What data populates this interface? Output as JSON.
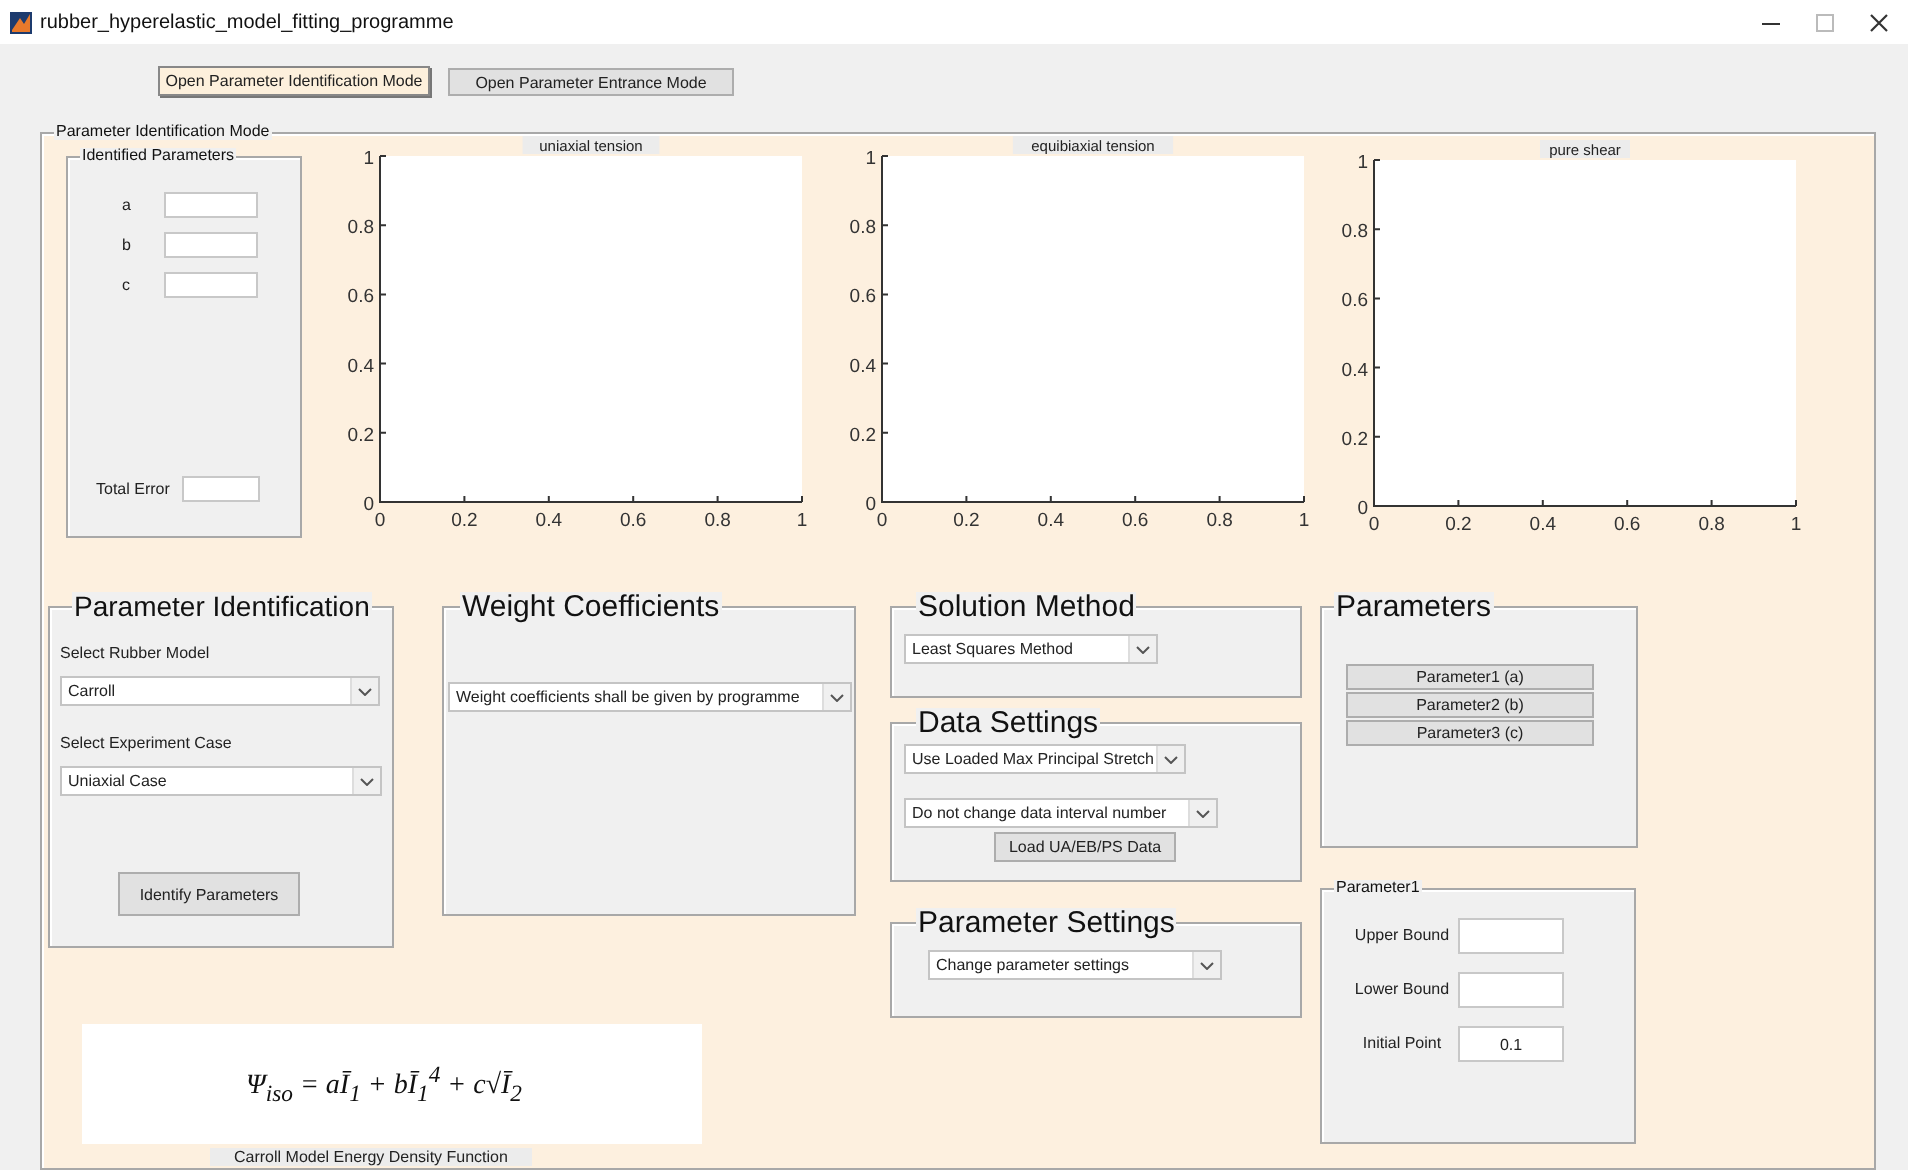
{
  "window": {
    "title": "rubber_hyperelastic_model_fitting_programme"
  },
  "mode_buttons": [
    {
      "label": "Open Parameter Identification Mode",
      "selected": true
    },
    {
      "label": "Open Parameter Entrance Mode",
      "selected": false
    }
  ],
  "mode_panel": {
    "title": "Parameter Identification Mode"
  },
  "identified_parameters": {
    "title": "Identified Parameters",
    "fields": [
      {
        "label": "a"
      },
      {
        "label": "b"
      },
      {
        "label": "c"
      }
    ],
    "total_error": {
      "label": "Total Error"
    }
  },
  "charts": [
    {
      "chart_data": {
        "type": "line",
        "title": "uniaxial tension",
        "xlim": [
          0,
          1
        ],
        "ylim": [
          0,
          1
        ],
        "xticks": [
          0,
          0.2,
          0.4,
          0.6,
          0.8,
          1
        ],
        "yticks": [
          0,
          0.2,
          0.4,
          0.6,
          0.8,
          1
        ]
      }
    },
    {
      "chart_data": {
        "type": "line",
        "title": "equibiaxial tension",
        "xlim": [
          0,
          1
        ],
        "ylim": [
          0,
          1
        ],
        "xticks": [
          0,
          0.2,
          0.4,
          0.6,
          0.8,
          1
        ],
        "yticks": [
          0,
          0.2,
          0.4,
          0.6,
          0.8,
          1
        ]
      }
    },
    {
      "chart_data": {
        "type": "line",
        "title": "pure shear",
        "xlim": [
          0,
          1
        ],
        "ylim": [
          0,
          1
        ],
        "xticks": [
          0,
          0.2,
          0.4,
          0.6,
          0.8,
          1
        ],
        "yticks": [
          0,
          0.2,
          0.4,
          0.6,
          0.8,
          1
        ]
      }
    }
  ],
  "parameter_identification": {
    "title": "Parameter Identification",
    "model_label": "Select Rubber Model",
    "model": "Carroll",
    "case_label": "Select Experiment Case",
    "case": "Uniaxial Case",
    "button": "Identify Parameters"
  },
  "weight_coefficients": {
    "title": "Weight Coefficients",
    "option": "Weight coefficients shall be given by programme"
  },
  "solution_method": {
    "title": "Solution Method",
    "option": "Least Squares Method"
  },
  "data_settings": {
    "title": "Data Settings",
    "stretch_option": "Use Loaded Max Principal Stretch",
    "interval_option": "Do not change data interval number",
    "load_button": "Load UA/EB/PS Data"
  },
  "parameter_settings": {
    "title": "Parameter Settings",
    "option": "Change parameter settings"
  },
  "parameters": {
    "title": "Parameters",
    "buttons": [
      "Parameter1 (a)",
      "Parameter2 (b)",
      "Parameter3 (c)"
    ]
  },
  "parameter_detail": {
    "title": "Parameter1",
    "fields": [
      {
        "label": "Upper Bound"
      },
      {
        "label": "Lower Bound"
      },
      {
        "label": "Initial Point",
        "value": "0.1"
      }
    ]
  },
  "formula": {
    "text": "Ψ$_{iso}$ = aĪ$_{1}$ + bĪ$_{1}$$^{4}$ + c√Ī$_{2}$",
    "caption": "Carroll Model Energy Density Function"
  }
}
